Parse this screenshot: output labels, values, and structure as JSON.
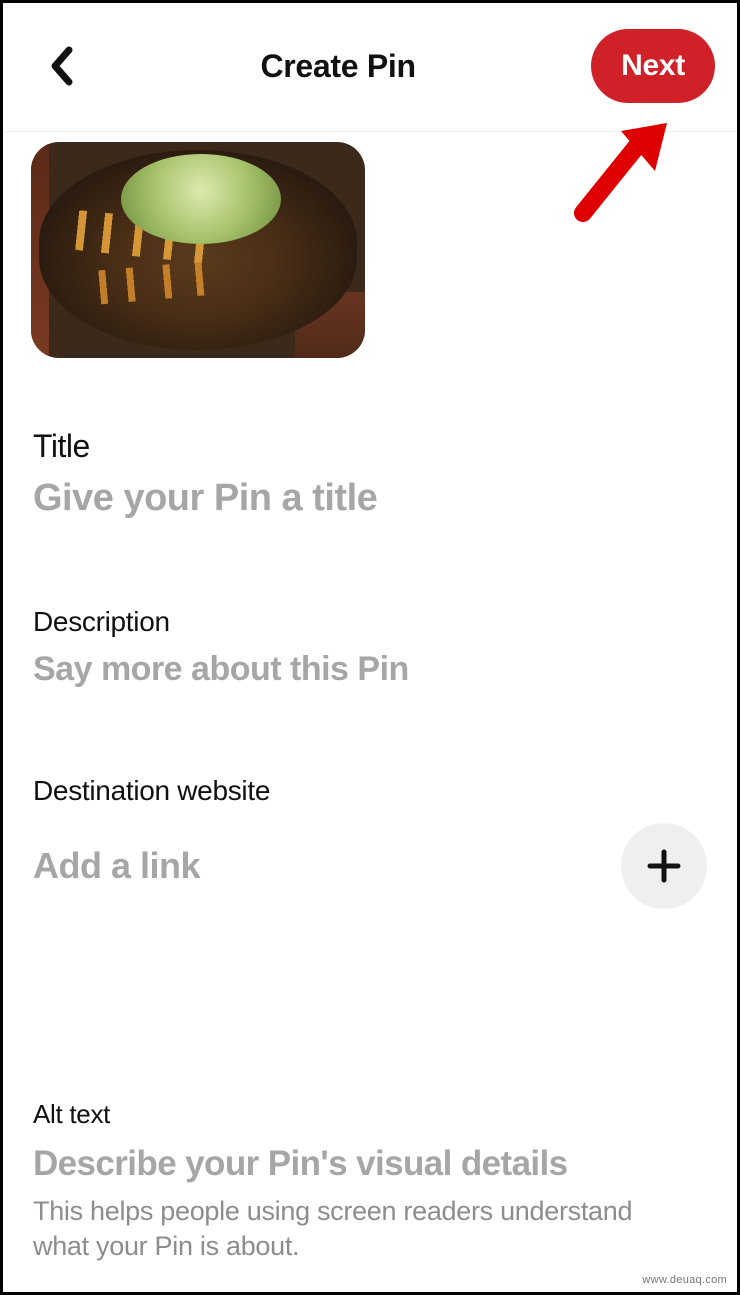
{
  "header": {
    "title": "Create Pin",
    "next_label": "Next"
  },
  "fields": {
    "title": {
      "label": "Title",
      "placeholder": "Give your Pin a title"
    },
    "description": {
      "label": "Description",
      "placeholder": "Say more about this Pin"
    },
    "link": {
      "label": "Destination website",
      "placeholder": "Add a link"
    },
    "alt": {
      "label": "Alt text",
      "placeholder": "Describe your Pin's visual details",
      "help": "This helps people using screen readers understand what your Pin is about."
    }
  },
  "icons": {
    "back": "chevron-left",
    "plus": "plus"
  },
  "watermark": "www.deuaq.com"
}
